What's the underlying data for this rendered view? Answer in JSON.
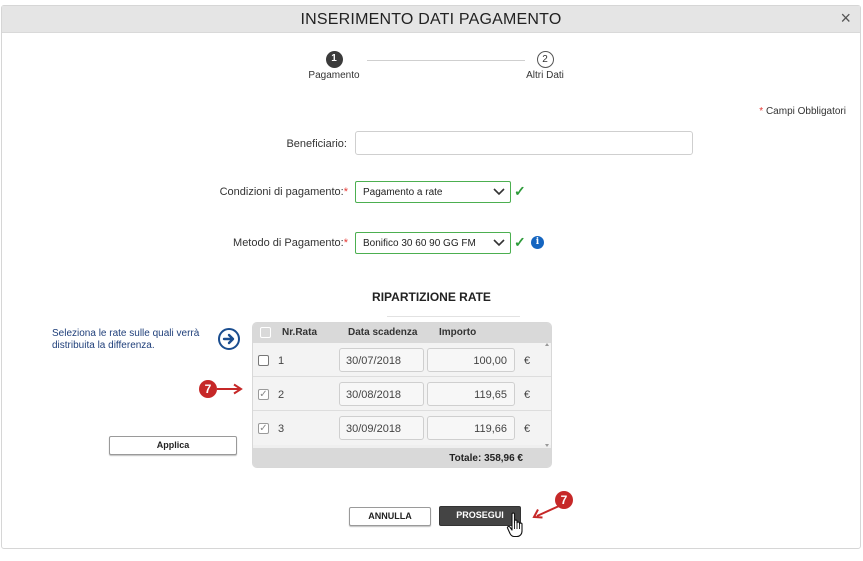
{
  "dialog": {
    "title": "INSERIMENTO DATI PAGAMENTO",
    "close_symbol": "×"
  },
  "steps": [
    {
      "number": "1",
      "label": "Pagamento",
      "active": true
    },
    {
      "number": "2",
      "label": "Altri Dati",
      "active": false
    }
  ],
  "required_note": {
    "asterisk": "*",
    "text": "Campi Obbligatori"
  },
  "form": {
    "beneficiario": {
      "label": "Beneficiario:",
      "value": ""
    },
    "condizioni": {
      "label": "Condizioni di pagamento:",
      "asterisk": "*",
      "value": "Pagamento a rate"
    },
    "metodo": {
      "label": "Metodo di Pagamento:",
      "asterisk": "*",
      "value": "Bonifico 30 60 90 GG FM"
    },
    "valid_symbol": "✓",
    "info_symbol": "i"
  },
  "installments": {
    "title": "RIPARTIZIONE RATE",
    "hint": "Seleziona le rate sulle quali verrà distribuita la differenza.",
    "columns": {
      "nr": "Nr.Rata",
      "date": "Data scadenza",
      "amount": "Importo"
    },
    "rows": [
      {
        "nr": "1",
        "date": "30/07/2018",
        "amount": "100,00",
        "currency": "€",
        "checked": false
      },
      {
        "nr": "2",
        "date": "30/08/2018",
        "amount": "119,65",
        "currency": "€",
        "checked": true
      },
      {
        "nr": "3",
        "date": "30/09/2018",
        "amount": "119,66",
        "currency": "€",
        "checked": true
      }
    ],
    "total": "Totale: 358,96 €",
    "apply_label": "Applica"
  },
  "callouts": {
    "row_badge": "7",
    "button_badge": "7"
  },
  "footer": {
    "cancel_label": "ANNULLA",
    "next_label": "PROSEGUI"
  },
  "colors": {
    "accent_green": "#4caf50",
    "callout_red": "#c62828",
    "info_blue": "#1565c0",
    "hint_blue": "#1f3f7a"
  },
  "icons": [
    "close-icon",
    "chevron-down-icon",
    "check-icon",
    "info-icon",
    "arrow-right-circle-icon",
    "hand-pointer-icon"
  ]
}
